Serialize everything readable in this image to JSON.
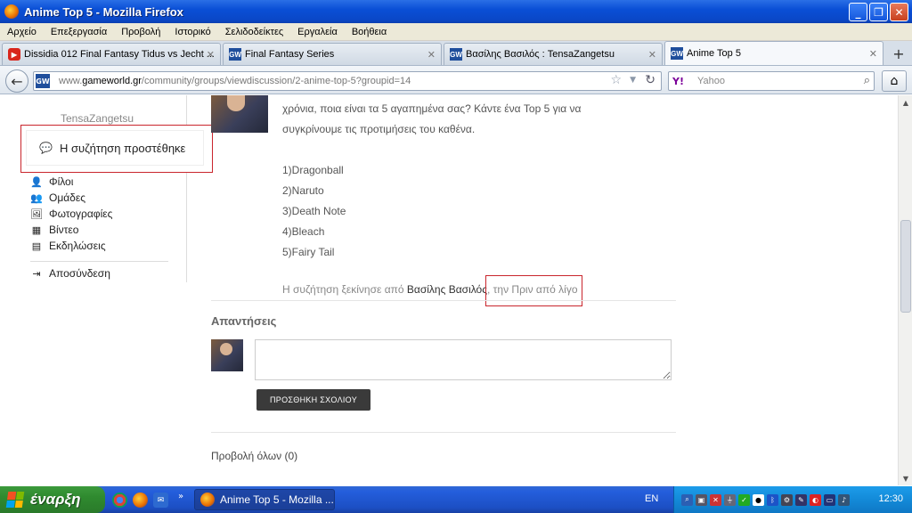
{
  "window": {
    "title": "Anime Top 5 - Mozilla Firefox"
  },
  "menu": [
    "Αρχείο",
    "Επεξεργασία",
    "Προβολή",
    "Ιστορικό",
    "Σελιδοδείκτες",
    "Εργαλεία",
    "Βοήθεια"
  ],
  "tabs": [
    {
      "label": "Dissidia 012 Final Fantasy Tidus vs Jecht ...",
      "icon": "youtube-icon"
    },
    {
      "label": "Final Fantasy Series",
      "icon": "gameworld-icon"
    },
    {
      "label": "Βασίλης Βασιλός : TensaZangetsu",
      "icon": "gameworld-icon"
    },
    {
      "label": "Anime Top 5",
      "icon": "gameworld-icon"
    }
  ],
  "favicon_text": "GW",
  "url": {
    "prefix": "www.",
    "domain": "gameworld.gr",
    "path": "/community/groups/viewdiscussion/2-anime-top-5?groupid=14"
  },
  "search": {
    "engine": "Y!",
    "placeholder": "Yahoo"
  },
  "sidebar": {
    "username": "TensaZangetsu",
    "notice": "Η συζήτηση προστέθηκε",
    "items": [
      {
        "label": "Φίλοι",
        "icon": "friends-icon"
      },
      {
        "label": "Ομάδες",
        "icon": "groups-icon"
      },
      {
        "label": "Φωτογραφίες",
        "icon": "photos-icon"
      },
      {
        "label": "Βίντεο",
        "icon": "video-icon"
      },
      {
        "label": "Εκδηλώσεις",
        "icon": "calendar-icon"
      }
    ],
    "logout": "Αποσύνδεση"
  },
  "post": {
    "line1": "χρόνια, ποια είναι τα 5 αγαπημένα σας? Κάντε ένα Top 5 για να",
    "line2": "συγκρίνουμε τις προτιμήσεις του καθένα.",
    "list": [
      "1)Dragonball",
      "2)Naruto",
      "3)Death Note",
      "4)Bleach",
      "5)Fairy Tail"
    ],
    "started_prefix": "Η συζήτηση ξεκίνησε από ",
    "author": "Βασίλης Βασιλός",
    "time": ", την Πριν από λίγο"
  },
  "replies": {
    "heading": "Απαντήσεις",
    "add_button": "ΠΡΟΣΘΗΚΗ ΣΧΟΛΙΟΥ",
    "view_all": "Προβολή όλων (0)"
  },
  "taskbar": {
    "start": "έναρξη",
    "task_label": "Anime Top 5 - Mozilla ...",
    "lang": "EN",
    "clock": "12:30"
  }
}
